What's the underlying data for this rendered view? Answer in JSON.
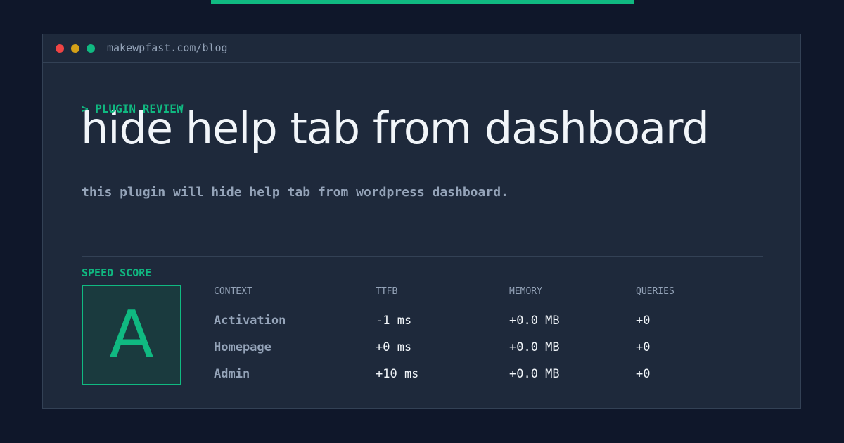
{
  "browser": {
    "url": "makewpfast.com/blog"
  },
  "hero": {
    "kicker": "> PLUGIN REVIEW",
    "title": "hide help tab from dashboard",
    "description": "this plugin will hide help tab from wordpress dashboard."
  },
  "speed_score": {
    "label": "SPEED SCORE",
    "grade": "A"
  },
  "metrics": {
    "headers": [
      "CONTEXT",
      "TTFB",
      "MEMORY",
      "QUERIES"
    ],
    "rows": [
      {
        "context": "Activation",
        "ttfb": "-1 ms",
        "memory": "+0.0 MB",
        "queries": "+0"
      },
      {
        "context": "Homepage",
        "ttfb": "+0 ms",
        "memory": "+0.0 MB",
        "queries": "+0"
      },
      {
        "context": "Admin",
        "ttfb": "+10 ms",
        "memory": "+0.0 MB",
        "queries": "+0"
      }
    ]
  },
  "colors": {
    "accent": "#10b981",
    "background": "#0f172a",
    "panel": "#1e293b",
    "muted_text": "#94a3b8",
    "text": "#f1f5f9"
  }
}
